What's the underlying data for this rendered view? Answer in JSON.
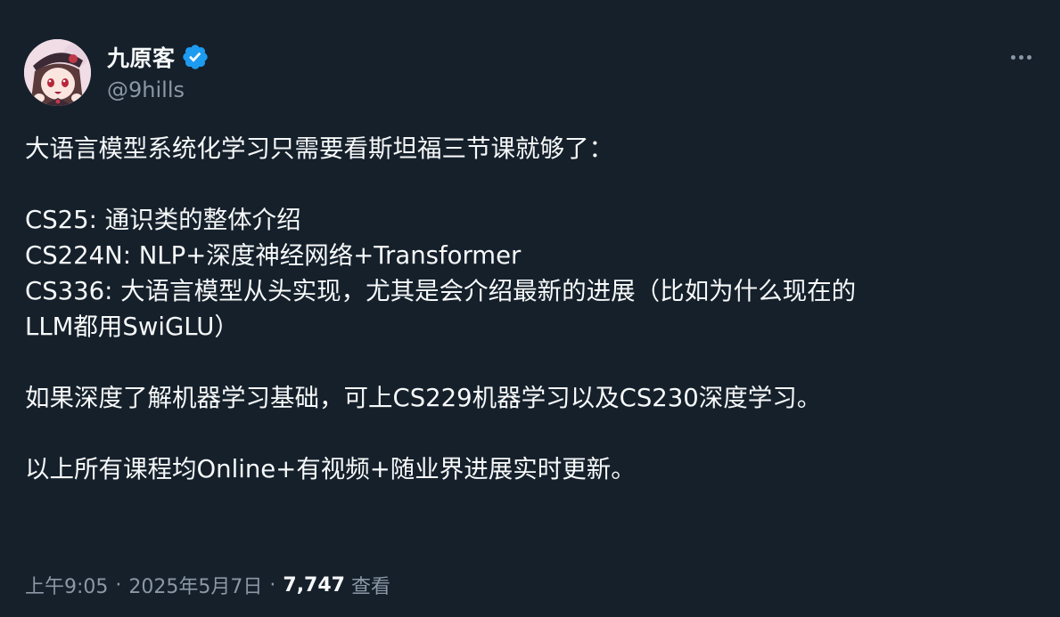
{
  "author": {
    "display_name": "九原客",
    "handle": "@9hills",
    "verified": true
  },
  "post": {
    "lines": [
      "大语言模型系统化学习只需要看斯坦福三节课就够了：",
      "",
      "CS25: 通识类的整体介绍",
      "CS224N: NLP+深度神经网络+Transformer",
      "CS336: 大语言模型从头实现，尤其是会介绍最新的进展（比如为什么现在的",
      "LLM都用SwiGLU）",
      "",
      "如果深度了解机器学习基础，可上CS229机器学习以及CS230深度学习。",
      "",
      "以上所有课程均Online+有视频+随业界进展实时更新。"
    ]
  },
  "meta": {
    "time": "上午9:05",
    "separator": "·",
    "date": "2025年5月7日",
    "views_count": "7,747",
    "views_label": "查看"
  },
  "icons": {
    "verified": "verified-badge-icon",
    "more": "more-horizontal-icon"
  },
  "colors": {
    "background": "#15202b",
    "primary_text": "#f7f9f9",
    "secondary_text": "#8b98a5",
    "verified_blue": "#1d9bf0"
  }
}
